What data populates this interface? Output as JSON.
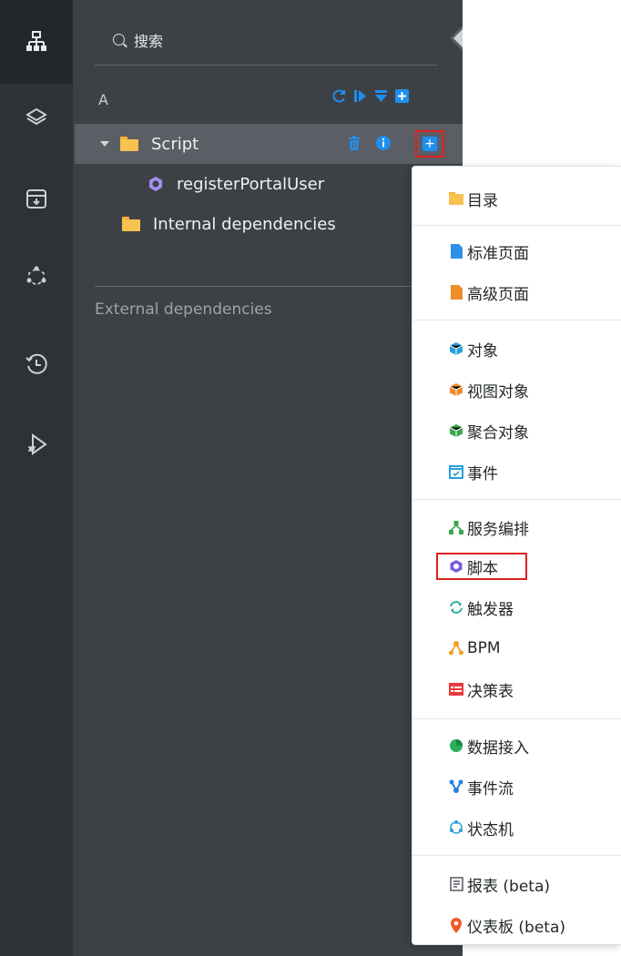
{
  "search": {
    "placeholder": "搜索"
  },
  "tree": {
    "group_label": "A",
    "items": [
      {
        "label": "Script"
      },
      {
        "label": "registerPortalUser"
      },
      {
        "label": "Internal dependencies"
      }
    ],
    "external_label": "External dependencies"
  },
  "context_menu": {
    "items": [
      {
        "label": "目录",
        "icon": "folder-icon",
        "color": "#f4b23a"
      },
      {
        "label": "标准页面",
        "icon": "page-icon",
        "color": "#2f8fe8"
      },
      {
        "label": "高级页面",
        "icon": "page-icon",
        "color": "#f08c2a"
      },
      {
        "label": "对象",
        "icon": "cube-icon",
        "color": "#2aa0d8"
      },
      {
        "label": "视图对象",
        "icon": "cube-icon",
        "color": "#f08c2a"
      },
      {
        "label": "聚合对象",
        "icon": "cube-icon",
        "color": "#3aa84a"
      },
      {
        "label": "事件",
        "icon": "calendar-icon",
        "color": "#2aa0d8"
      },
      {
        "label": "服务编排",
        "icon": "flow-icon",
        "color": "#3aa84a"
      },
      {
        "label": "脚本",
        "icon": "hexagon-icon",
        "color": "#7a5de0"
      },
      {
        "label": "触发器",
        "icon": "trigger-icon",
        "color": "#2bb0a0"
      },
      {
        "label": "BPM",
        "icon": "bpm-icon",
        "color": "#f0a020"
      },
      {
        "label": "决策表",
        "icon": "table-icon",
        "color": "#e83a3a"
      },
      {
        "label": "数据接入",
        "icon": "pie-icon",
        "color": "#2ab05a"
      },
      {
        "label": "事件流",
        "icon": "network-icon",
        "color": "#2a7ee0"
      },
      {
        "label": "状态机",
        "icon": "cycle-icon",
        "color": "#2aa0d8"
      },
      {
        "label": "报表 (beta)",
        "icon": "report-icon",
        "color": "#555a60"
      },
      {
        "label": "仪表板 (beta)",
        "icon": "pin-icon",
        "color": "#f05a2a"
      }
    ]
  }
}
